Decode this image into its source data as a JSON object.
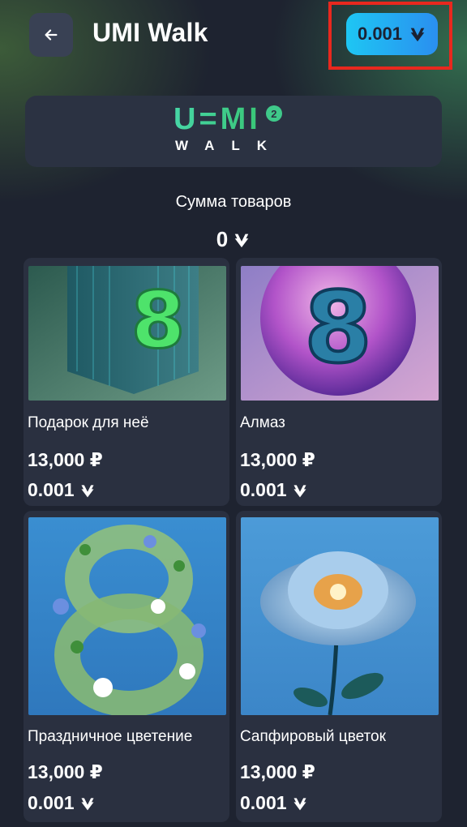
{
  "header": {
    "title": "UMI Walk",
    "balance": "0.001"
  },
  "logo": {
    "word": "U=MI",
    "badge": "2",
    "sub": "WALK"
  },
  "summary": {
    "label": "Сумма товаров",
    "value": "0"
  },
  "products": [
    {
      "name": "Подарок для неё",
      "price_rub": "13,000 ₽",
      "price_umi": "0.001"
    },
    {
      "name": "Алмаз",
      "price_rub": "13,000 ₽",
      "price_umi": "0.001"
    },
    {
      "name": "Праздничное цветение",
      "price_rub": "13,000 ₽",
      "price_umi": "0.001"
    },
    {
      "name": "Сапфировый цветок",
      "price_rub": "13,000 ₽",
      "price_umi": "0.001"
    }
  ],
  "colors": {
    "background": "#1e2330",
    "card": "#2a3040",
    "accent_gradient_start": "#1ec6f3",
    "accent_gradient_end": "#2a8ff0",
    "brand_green": "#3ad08a",
    "highlight_red": "#e8281e"
  },
  "icons": {
    "back": "arrow-left-icon",
    "currency": "umi-coin-icon"
  }
}
